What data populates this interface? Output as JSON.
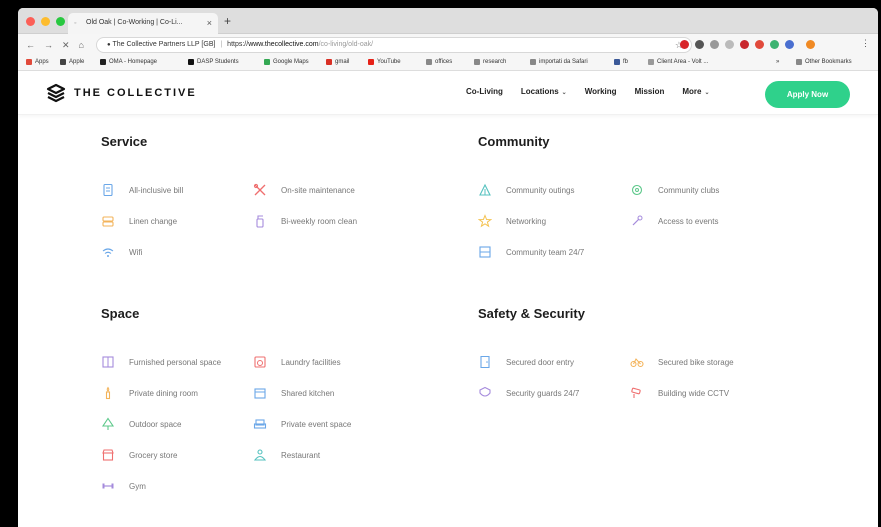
{
  "browser": {
    "tab_title": "Old Oak | Co-Working | Co-Li...",
    "tab_close": "×",
    "new_tab": "+",
    "back": "←",
    "forward": "→",
    "reload": "✕",
    "home": "⌂",
    "lock": "🔒",
    "site_identity": "The Collective Partners LLP [GB]",
    "url_scheme": "https://",
    "url_host": "www.thecollective.com",
    "url_path": "/co-living/old-oak/",
    "bookmark_star": "☆",
    "menu": "⋮"
  },
  "bookmarks": [
    {
      "label": "Apps",
      "color": "#e14a3b"
    },
    {
      "label": "Apple",
      "color": "#444444"
    },
    {
      "label": "OMA - Homepage",
      "color": "#222222"
    },
    {
      "label": "DASP Students",
      "color": "#111111"
    },
    {
      "label": "Google Maps",
      "color": "#34a853"
    },
    {
      "label": "gmail",
      "color": "#d93025"
    },
    {
      "label": "YouTube",
      "color": "#e62117"
    },
    {
      "label": "offices",
      "color": "#888888"
    },
    {
      "label": "research",
      "color": "#888888"
    },
    {
      "label": "importati da Safari",
      "color": "#888888"
    },
    {
      "label": "fb",
      "color": "#3b5998"
    },
    {
      "label": "Client Area - Volt ...",
      "color": "#999999"
    },
    {
      "label": "»",
      "color": ""
    },
    {
      "label": "Other Bookmarks",
      "color": "#888888"
    }
  ],
  "navbar": {
    "logo_text": "THE COLLECTIVE",
    "links": [
      "Co-Living",
      "Locations",
      "Working",
      "Mission",
      "More"
    ],
    "dropdown_chevron": "⌄",
    "apply_label": "Apply Now"
  },
  "sections": {
    "service": {
      "title": "Service",
      "items": [
        "All-inclusive bill",
        "On-site maintenance",
        "Linen change",
        "Bi-weekly room clean",
        "Wifi"
      ]
    },
    "community": {
      "title": "Community",
      "items": [
        "Community outings",
        "Community clubs",
        "Networking",
        "Access to events",
        "Community team 24/7"
      ]
    },
    "space": {
      "title": "Space",
      "items": [
        "Furnished personal space",
        "Laundry facilities",
        "Private dining room",
        "Shared kitchen",
        "Outdoor space",
        "Private event space",
        "Grocery store",
        "Restaurant",
        "Gym"
      ]
    },
    "safety": {
      "title": "Safety & Security",
      "items": [
        "Secured door entry",
        "Secured bike storage",
        "Security guards 24/7",
        "Building wide CCTV"
      ]
    }
  },
  "colors": {
    "accent": "#2fd18b",
    "blue": "#6aa7e8",
    "orange": "#f3b35a",
    "red": "#ef6f6f",
    "purple": "#a58bdc",
    "green": "#5cc88a",
    "teal": "#55c2bf",
    "yellow": "#f4c250"
  }
}
